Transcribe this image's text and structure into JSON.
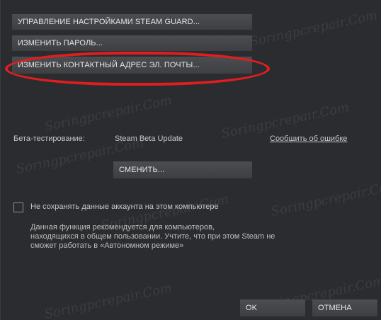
{
  "buttons": {
    "steam_guard": "УПРАВЛЕНИЕ НАСТРОЙКАМИ STEAM GUARD...",
    "change_password": "ИЗМЕНИТЬ ПАРОЛЬ...",
    "change_email": "ИЗМЕНИТЬ КОНТАКТНЫЙ АДРЕС ЭЛ. ПОЧТЫ...",
    "change": "СМЕНИТЬ...",
    "ok": "OK",
    "cancel": "ОТМЕНА"
  },
  "beta": {
    "label": "Бета-тестирование:",
    "value": "Steam Beta Update",
    "report_link": "Сообщить об ошибке"
  },
  "checkbox": {
    "label": "Не сохранять данные аккаунта на этом компьютере",
    "checked": false
  },
  "description": {
    "line1": "Данная функция рекомендуется для компьютеров,",
    "line2": "находящихся в общем пользовании. Учтите, что при этом Steam не",
    "line3": "сможет работать в «Автономном режиме»"
  },
  "watermark_text": "Soringpcrepair.Com",
  "colors": {
    "background": "#2b2c2f",
    "button": "#46474a",
    "highlight": "#e01e20"
  }
}
